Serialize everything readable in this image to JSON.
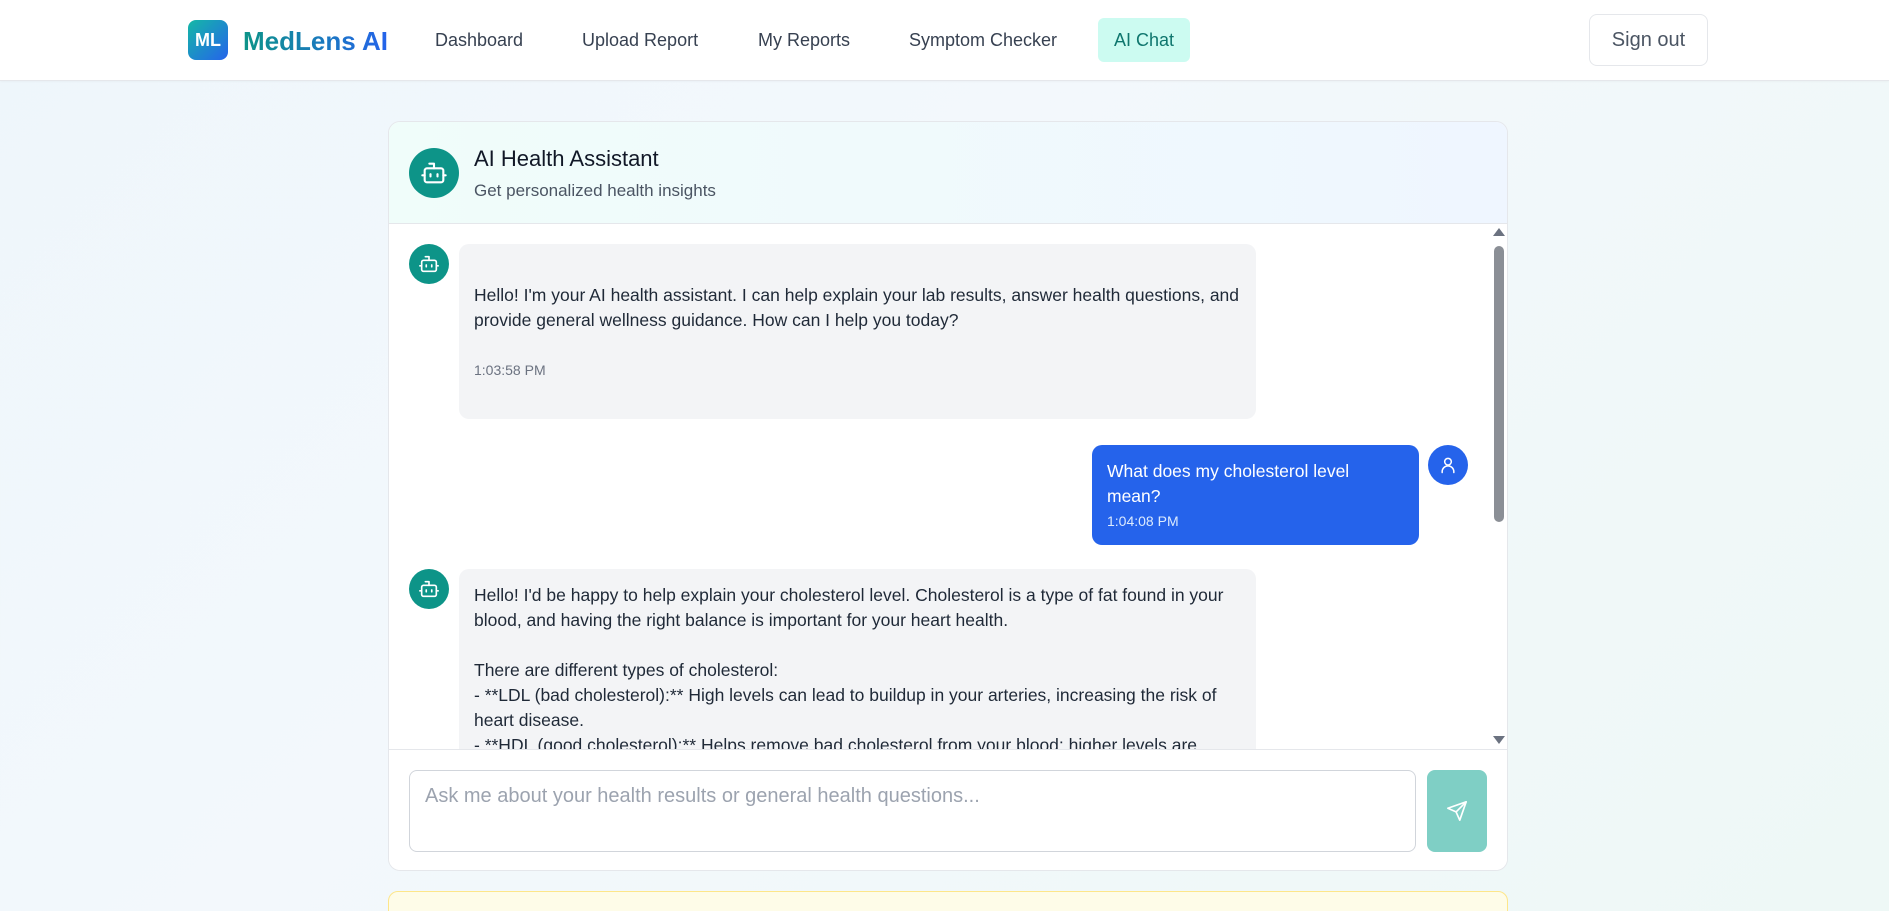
{
  "nav": {
    "logo_initials": "ML",
    "brand": "MedLens AI",
    "items": [
      {
        "label": "Dashboard",
        "active": false
      },
      {
        "label": "Upload Report",
        "active": false
      },
      {
        "label": "My Reports",
        "active": false
      },
      {
        "label": "Symptom Checker",
        "active": false
      },
      {
        "label": "AI Chat",
        "active": true
      }
    ],
    "signout_label": "Sign out"
  },
  "chat": {
    "title": "AI Health Assistant",
    "subtitle": "Get personalized health insights",
    "messages": [
      {
        "role": "assistant",
        "text": "Hello! I'm your AI health assistant. I can help explain your lab results, answer health questions, and provide general wellness guidance. How can I help you today?",
        "time": "1:03:58 PM"
      },
      {
        "role": "user",
        "text": "What does my cholesterol level mean?",
        "time": "1:04:08 PM"
      },
      {
        "role": "assistant",
        "text": "Hello! I'd be happy to help explain your cholesterol level. Cholesterol is a type of fat found in your blood, and having the right balance is important for your heart health.\n\nThere are different types of cholesterol:\n- **LDL (bad cholesterol):** High levels can lead to buildup in your arteries, increasing the risk of heart disease.\n- **HDL (good cholesterol):** Helps remove bad cholesterol from your blood; higher levels are generally better.\n- **Total cholesterol:** The overall amount of cholesterol in your blood, which includes LDL and HDL.",
        "time": ""
      }
    ],
    "input_placeholder": "Ask me about your health results or general health questions..."
  },
  "icons": {
    "bot": "bot-icon",
    "user": "user-icon",
    "send": "send-icon"
  },
  "colors": {
    "accent_teal": "#0d9488",
    "user_bubble": "#2563eb",
    "active_nav_bg": "#ccfbf1",
    "send_disabled": "#7fcfc5"
  }
}
